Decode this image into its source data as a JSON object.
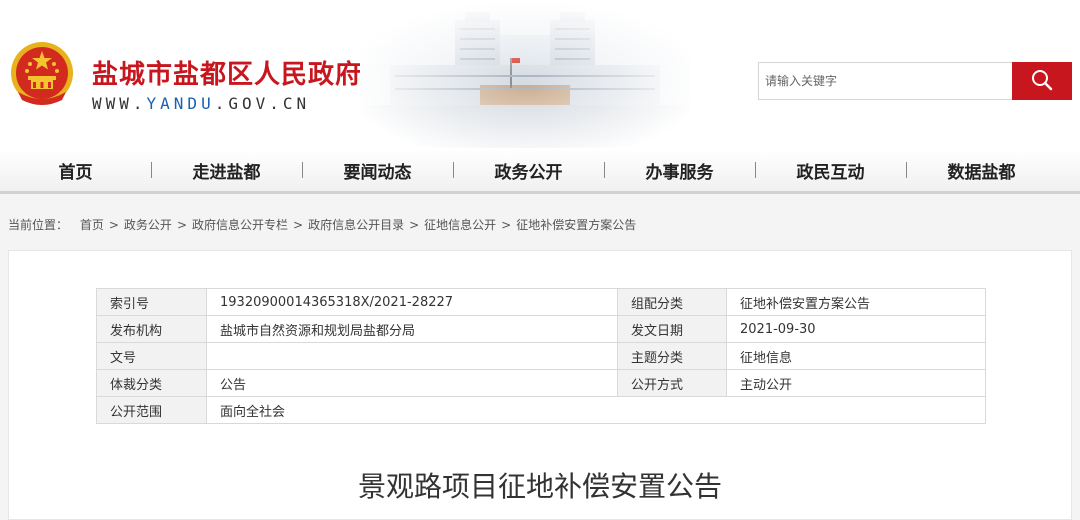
{
  "header": {
    "site_name": "盐城市盐都区人民政府",
    "url_prefix": "WWW.",
    "url_highlight": "YANDU",
    "url_suffix": ".GOV.CN",
    "brand_color": "#c8161e"
  },
  "search": {
    "placeholder": "请输入关键字",
    "button_icon": "search-icon"
  },
  "nav": {
    "items": [
      "首页",
      "走进盐都",
      "要闻动态",
      "政务公开",
      "办事服务",
      "政民互动",
      "数据盐都"
    ]
  },
  "breadcrumb": {
    "label": "当前位置：",
    "items": [
      "首页",
      "政务公开",
      "政府信息公开专栏",
      "政府信息公开目录",
      "征地信息公开",
      "征地补偿安置方案公告"
    ],
    "separator": ">"
  },
  "meta_table": {
    "rows": [
      {
        "k1": "索引号",
        "v1": "19320900014365318X/2021-28227",
        "k2": "组配分类",
        "v2": "征地补偿安置方案公告"
      },
      {
        "k1": "发布机构",
        "v1": "盐城市自然资源和规划局盐都分局",
        "k2": "发文日期",
        "v2": "2021-09-30"
      },
      {
        "k1": "文号",
        "v1": "",
        "k2": "主题分类",
        "v2": "征地信息"
      },
      {
        "k1": "体裁分类",
        "v1": "公告",
        "k2": "公开方式",
        "v2": "主动公开"
      },
      {
        "k1": "公开范围",
        "v1": "面向全社会"
      }
    ]
  },
  "article": {
    "title": "景观路项目征地补偿安置公告"
  }
}
